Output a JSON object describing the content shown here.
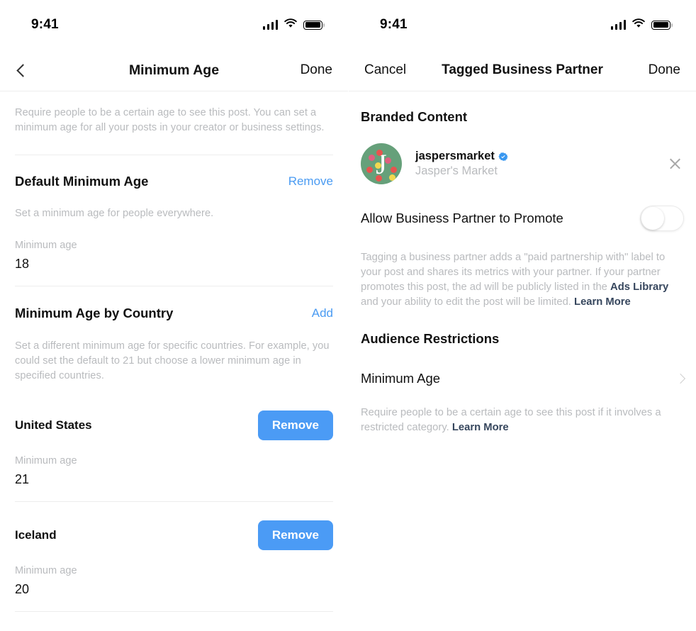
{
  "left": {
    "status": {
      "time": "9:41",
      "signal_icon": "cellular-signal-icon",
      "wifi_icon": "wifi-icon",
      "battery_icon": "battery-full-icon"
    },
    "nav": {
      "back_icon": "chevron-left-icon",
      "title": "Minimum Age",
      "done_label": "Done"
    },
    "intro": "Require people to be a certain age to see this post. You can set a minimum age for all your posts in your creator or business settings.",
    "default_section": {
      "title": "Default Minimum Age",
      "action_label": "Remove",
      "description": "Set a minimum age for people everywhere.",
      "field_label": "Minimum age",
      "field_value": "18"
    },
    "country_section": {
      "title": "Minimum Age by Country",
      "action_label": "Add",
      "description": "Set a different minimum age for specific countries. For example, you could set the default to 21 but choose a lower minimum age in specified countries.",
      "field_label": "Minimum age",
      "countries": [
        {
          "name": "United States",
          "button_label": "Remove",
          "age_label": "Minimum age",
          "age_value": "21"
        },
        {
          "name": "Iceland",
          "button_label": "Remove",
          "age_label": "Minimum age",
          "age_value": "20"
        }
      ]
    }
  },
  "right": {
    "status": {
      "time": "9:41",
      "signal_icon": "cellular-signal-icon",
      "wifi_icon": "wifi-icon",
      "battery_icon": "battery-full-icon"
    },
    "nav": {
      "cancel_label": "Cancel",
      "title": "Tagged Business Partner",
      "done_label": "Done"
    },
    "branded": {
      "title": "Branded Content",
      "partner": {
        "username": "jaspersmarket",
        "display_name": "Jasper's Market",
        "verified_icon": "verified-badge-icon",
        "avatar_icon": "profile-avatar",
        "remove_icon": "close-icon"
      },
      "toggle": {
        "label": "Allow Business Partner to Promote",
        "state": "off"
      },
      "disclaimer_part1": "Tagging a business partner adds a \"paid partnership with\" label to your post and shares its metrics with your partner. If your partner promotes this post, the ad will be publicly listed in the ",
      "disclaimer_link1": "Ads Library",
      "disclaimer_part2": " and your ability to edit the post will be limited. ",
      "disclaimer_link2": "Learn More"
    },
    "audience": {
      "title": "Audience Restrictions",
      "row_label": "Minimum Age",
      "chevron_icon": "chevron-right-icon",
      "description_part1": "Require people to be a certain age to see this post if it involves a restricted category. ",
      "description_link": "Learn More"
    }
  },
  "colors": {
    "accent_blue": "#4b9bf5",
    "link_blue": "#4a9bf2",
    "muted_text": "#b9bbbe",
    "dark_link": "#36465d",
    "avatar_green": "#66a07a"
  }
}
